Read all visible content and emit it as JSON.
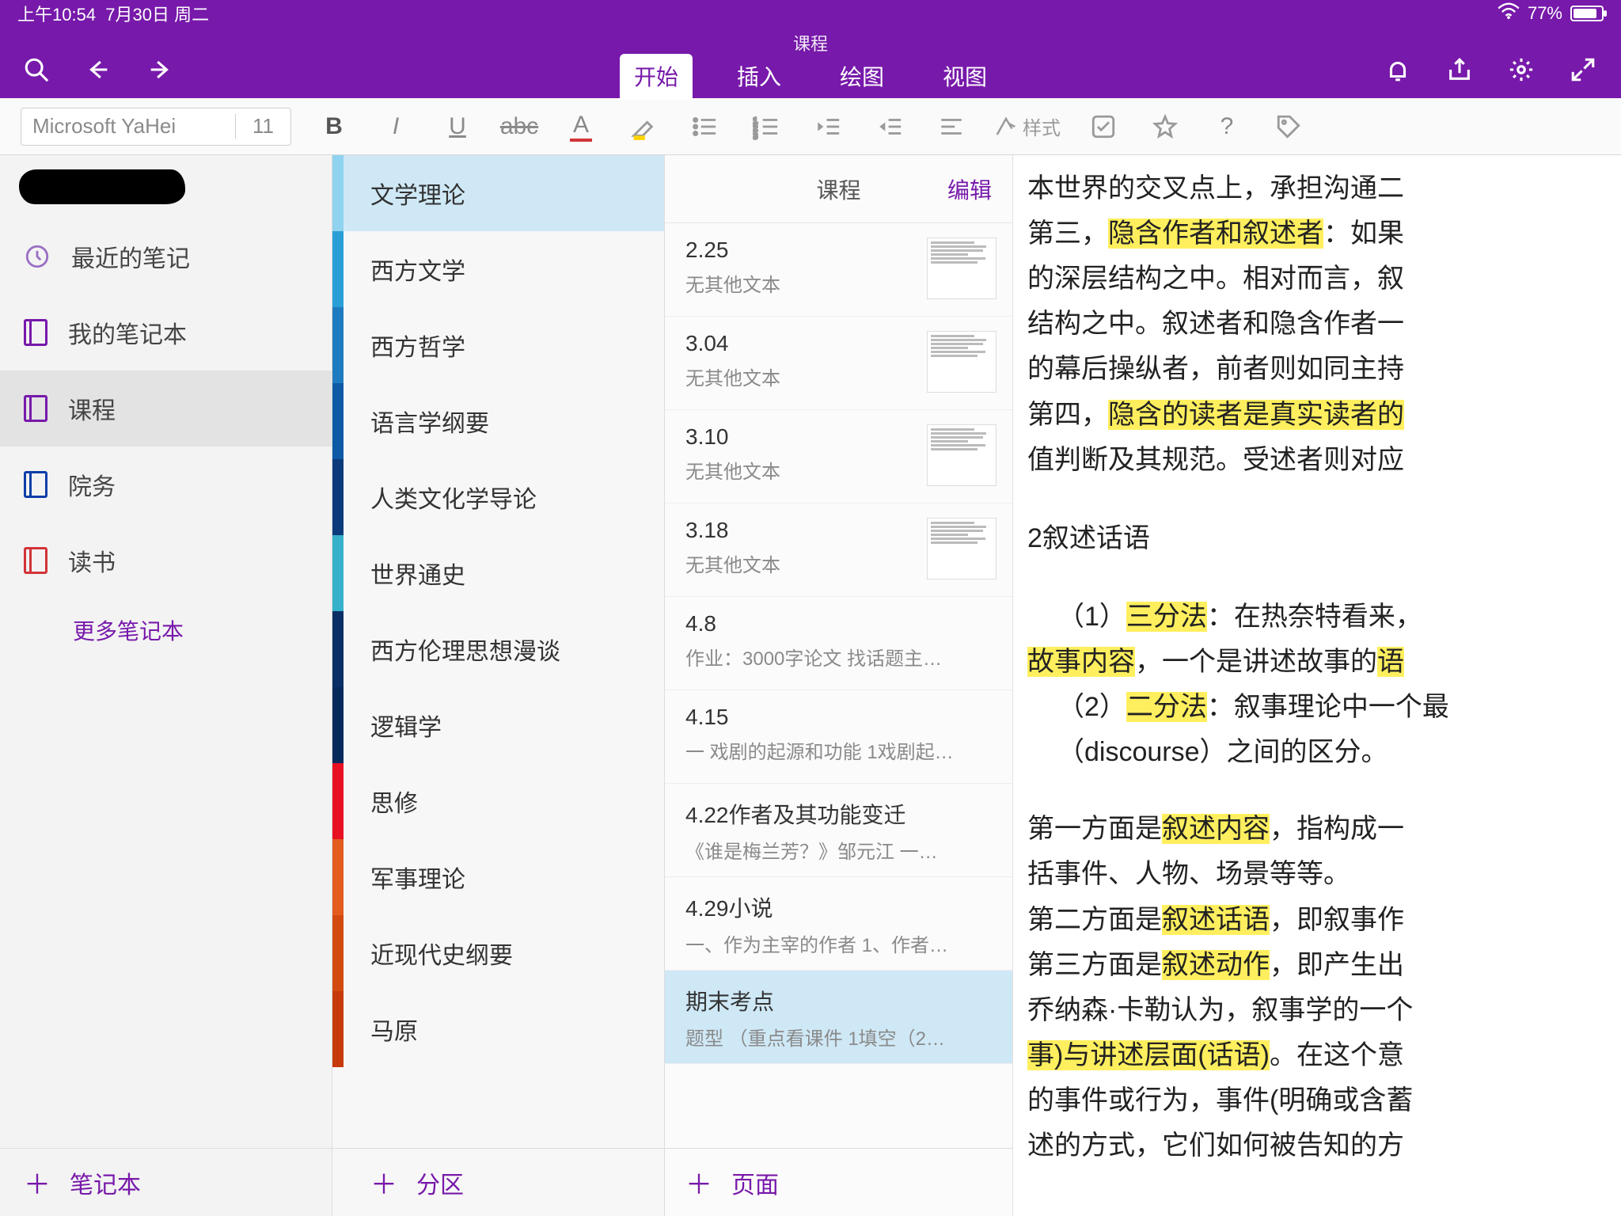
{
  "status": {
    "time": "上午10:54",
    "date": "7月30日 周二",
    "battery": "77%"
  },
  "header": {
    "doc_title": "课程",
    "tabs": [
      "开始",
      "插入",
      "绘图",
      "视图"
    ],
    "active_tab": 0
  },
  "ribbon": {
    "font_name": "Microsoft YaHei",
    "font_size": "11",
    "style_label": "样式"
  },
  "sidebar": {
    "recent": "最近的笔记",
    "notebooks": [
      {
        "label": "我的笔记本",
        "color": "#7719AA"
      },
      {
        "label": "课程",
        "color": "#7719AA",
        "selected": true
      },
      {
        "label": "院务",
        "color": "#0b3ea8"
      },
      {
        "label": "读书",
        "color": "#d13438"
      }
    ],
    "more": "更多笔记本",
    "add": "笔记本"
  },
  "sections": {
    "items": [
      {
        "label": "文学理论",
        "color": "#8fd3f0",
        "selected": true
      },
      {
        "label": "西方文学",
        "color": "#2a9fd6"
      },
      {
        "label": "西方哲学",
        "color": "#1f7bbf"
      },
      {
        "label": "语言学纲要",
        "color": "#0e5aa7"
      },
      {
        "label": "人类文化学导论",
        "color": "#0b3b7a"
      },
      {
        "label": "世界通史",
        "color": "#36b1c9"
      },
      {
        "label": "西方伦理思想漫谈",
        "color": "#0a2f66"
      },
      {
        "label": "逻辑学",
        "color": "#062a5c"
      },
      {
        "label": "思修",
        "color": "#e81123"
      },
      {
        "label": "军事理论",
        "color": "#e25c1e"
      },
      {
        "label": "近现代史纲要",
        "color": "#d24a0f"
      },
      {
        "label": "马原",
        "color": "#c73b0a"
      }
    ],
    "add": "分区"
  },
  "pages": {
    "title": "课程",
    "edit": "编辑",
    "items": [
      {
        "title": "2.25",
        "sub": "无其他文本",
        "thumb": true
      },
      {
        "title": "3.04",
        "sub": "无其他文本",
        "thumb": true
      },
      {
        "title": "3.10",
        "sub": "无其他文本",
        "thumb": true
      },
      {
        "title": "3.18",
        "sub": "无其他文本",
        "thumb": true
      },
      {
        "title": "4.8",
        "sub": "作业：3000字论文  找话题主…"
      },
      {
        "title": "4.15",
        "sub": "一 戏剧的起源和功能  1戏剧起…"
      },
      {
        "title": "4.22作者及其功能变迁",
        "sub": "《谁是梅兰芳？》邹元江  一…"
      },
      {
        "title": "4.29小说",
        "sub": "一、作为主宰的作者  1、作者…"
      },
      {
        "title": "期末考点",
        "sub": "题型  （重点看课件  1填空（2…",
        "selected": true
      }
    ],
    "add": "页面"
  },
  "content": {
    "l1a": "本世界的交叉点上，承担沟通二",
    "l2a": "第三，",
    "l2b": "隐含作者和叙述者",
    "l2c": "：如果",
    "l3": "的深层结构之中。相对而言，叙",
    "l4": "结构之中。叙述者和隐含作者一",
    "l5": "的幕后操纵者，前者则如同主持",
    "l6a": "第四，",
    "l6b": "隐含的读者是真实读者的",
    "l7": "值判断及其规范。受述者则对应",
    "h2": "2叙述话语",
    "l8a": "（1）",
    "l8b": "三分法",
    "l8c": "：在热奈特看来，",
    "l9a": "故事内容",
    "l9b": "，一个是讲述故事的",
    "l9c": "语",
    "l10a": "（2）",
    "l10b": "二分法",
    "l10c": "：叙事理论中一个最",
    "l11": "（discourse）之间的区分。",
    "l12a": "第一方面是",
    "l12b": "叙述内容",
    "l12c": "，指构成一",
    "l13": "括事件、人物、场景等等。",
    "l14a": "第二方面是",
    "l14b": "叙述话语",
    "l14c": "，即叙事作",
    "l15a": "第三方面是",
    "l15b": "叙述动作",
    "l15c": "，即产生出",
    "l16a": "乔纳森·卡勒认为，叙事学的一个",
    "l17a": "事)",
    "l17b": "与讲述层面(话语)",
    "l17c": "。在这个意",
    "l18": "的事件或行为，事件(明确或含蓄",
    "l19": "述的方式，它们如何被告知的方"
  }
}
